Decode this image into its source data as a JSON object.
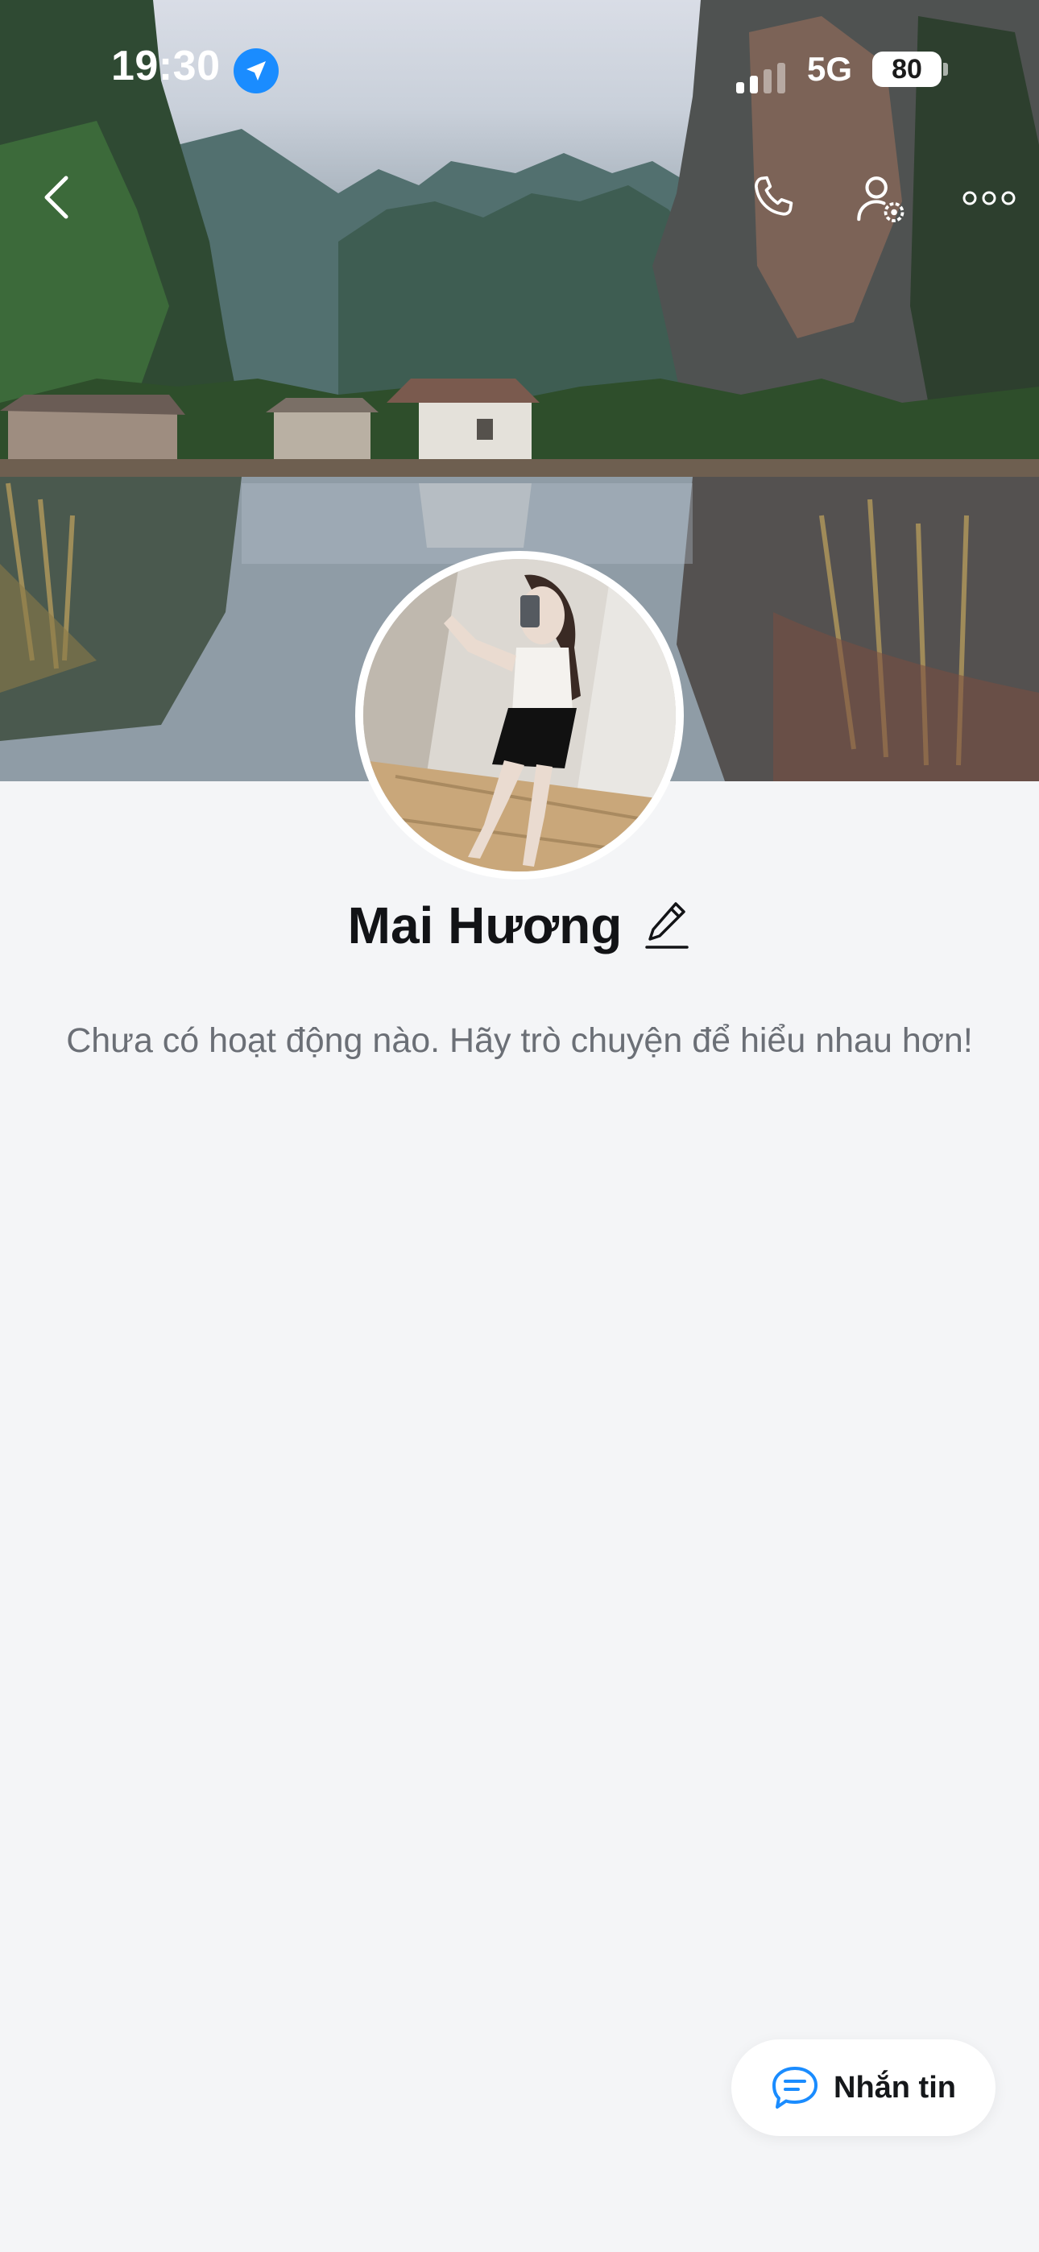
{
  "status_bar": {
    "time": "19:30",
    "network": "5G",
    "battery": "80",
    "location_icon": "location-arrow-icon"
  },
  "header": {
    "back_icon": "chevron-left-icon",
    "call_icon": "phone-icon",
    "friend_settings_icon": "user-gear-icon",
    "more_icon": "more-dots-icon"
  },
  "profile": {
    "name": "Mai Hương",
    "edit_icon": "pencil-icon",
    "empty_message": "Chưa có hoạt động nào. Hãy trò chuyện để hiểu nhau hơn!"
  },
  "message_button": {
    "label": "Nhắn tin",
    "icon": "chat-bubble-icon"
  },
  "colors": {
    "accent": "#1a8cff",
    "background": "#f4f5f7",
    "text_primary": "#121316",
    "text_secondary": "#6b6f76"
  }
}
